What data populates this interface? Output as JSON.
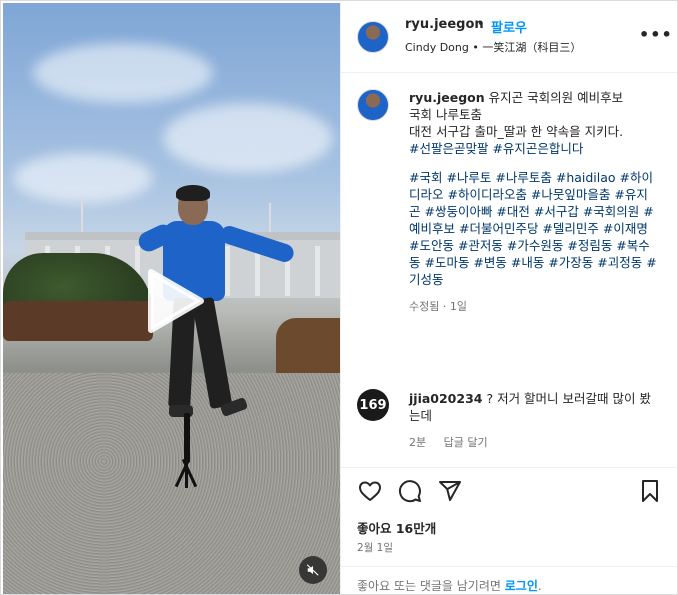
{
  "post": {
    "username": "ryu.jeegon",
    "follow_label": "팔로우",
    "separator": "•",
    "subtitle": "Cindy Dong • 一笑江湖（科目三）",
    "more_label": "•••"
  },
  "caption": {
    "username": "ryu.jeegon",
    "text_line1": "유지곤 국회의원 예비후보",
    "text_line2": "국회 나루토춤",
    "text_line3": "대전 서구갑 출마_딸과 한 약속을 지키다.",
    "hashtags1": "#선팔은곧맞팔 #유지곤은합니다",
    "hashtags2": "#국회 #나루토 #나루토춤 #haidilao #하이디라오 #하이디라오춤 #나뭇잎마을춤 #유지곤 #쌍둥이아빠 #대전 #서구갑 #국회의원 #예비후보 #더불어민주당 #델리민주 #이재명 #도안동 #관저동 #가수원동 #정림동 #복수동 #도마동 #변동 #내동 #가장동 #괴정동 #기성동",
    "edited": "수정됨 · 1일"
  },
  "comment": {
    "avatar_text": "169",
    "username": "jjia020234",
    "text": "? 저거 할머니 보러갈때 많이 봤는데",
    "time": "2분",
    "reply_label": "답글 달기"
  },
  "actions": {
    "likes": "좋아요 16만개",
    "date": "2월 1일",
    "login_prompt": "좋아요 또는 댓글을 남기려면 ",
    "login_link": "로그인",
    "login_suffix": "."
  },
  "icons": {
    "like": "heart-icon",
    "comment": "comment-bubble-icon",
    "share": "paper-plane-icon",
    "save": "bookmark-icon",
    "play": "play-icon",
    "mute": "speaker-muted-icon"
  }
}
